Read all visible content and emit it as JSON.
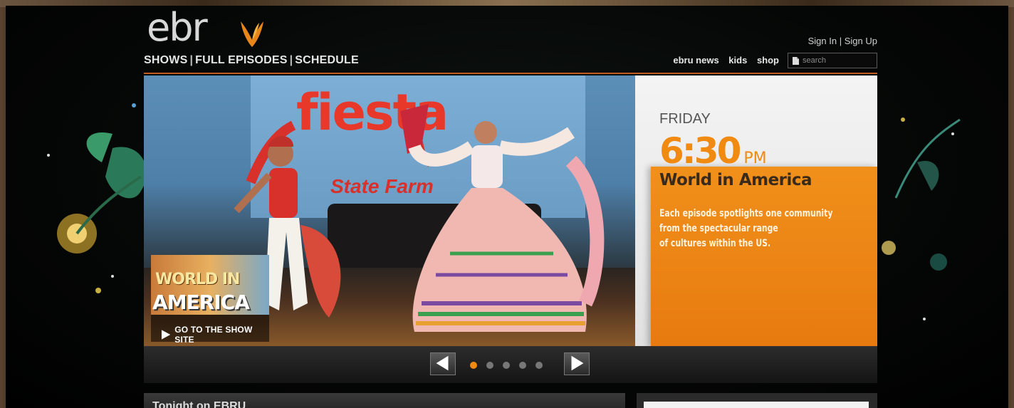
{
  "header": {
    "logo_text": "ebru",
    "main_nav": [
      "SHOWS",
      "FULL EPISODES",
      "SCHEDULE"
    ],
    "auth": {
      "sign_in": "Sign In",
      "separator": "|",
      "sign_up": "Sign Up"
    },
    "sub_nav": [
      "ebru news",
      "kids",
      "shop"
    ],
    "search": {
      "placeholder": "search",
      "value": ""
    }
  },
  "hero": {
    "photo_banner_text": "fiesta",
    "photo_sponsor_text": "State Farm",
    "show_badge": {
      "title_line1": "WORLD IN",
      "title_line2": "AMERICA",
      "link_label": "GO TO THE SHOW SITE"
    },
    "schedule": {
      "day": "FRIDAY",
      "time": "6:30",
      "ampm": "PM",
      "show_title": "World in America",
      "description_lines": [
        "Each episode spotlights one community",
        "from the spectacular range",
        "of cultures within the US."
      ]
    }
  },
  "carousel": {
    "slide_count": 5,
    "active_index": 0
  },
  "lower": {
    "section_title": "Tonight on EBRU"
  },
  "colors": {
    "accent_orange": "#f08a10",
    "hero_border": "#c05a20",
    "nav_text": "#e6e6e6"
  },
  "icons": {
    "search": "document-icon",
    "goto": "play-icon",
    "prev": "arrow-left-icon",
    "next": "arrow-right-icon",
    "logo": "leaf-icon"
  }
}
